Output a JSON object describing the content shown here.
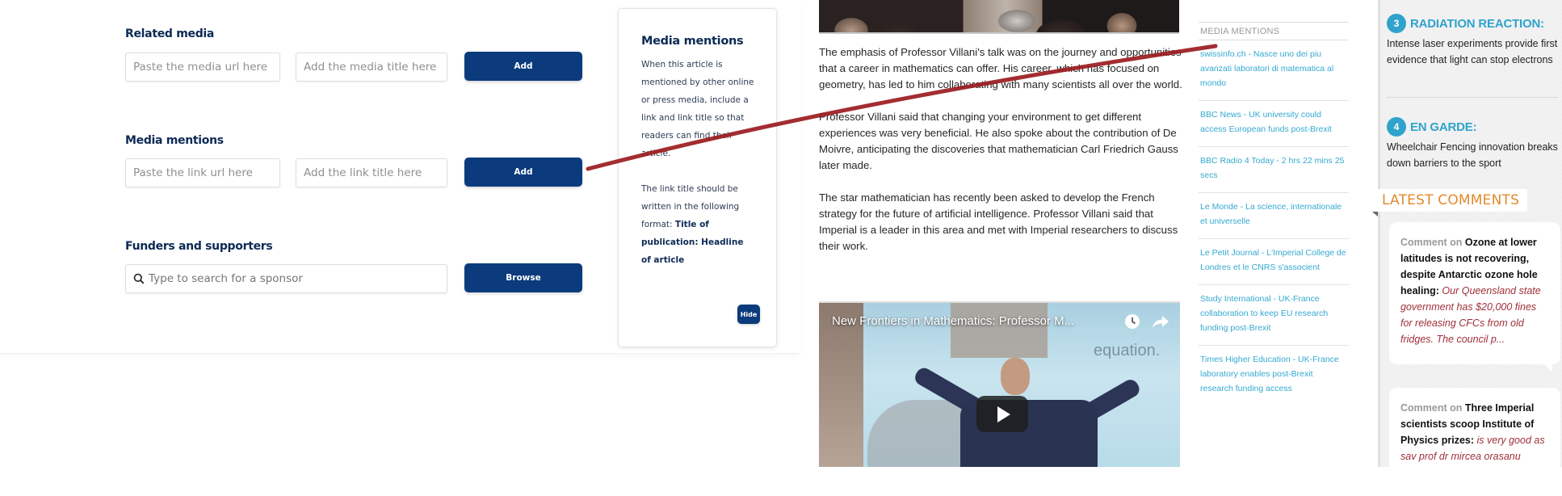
{
  "form": {
    "related_media": {
      "label": "Related media",
      "url_placeholder": "Paste the media url here",
      "title_placeholder": "Add the media title here",
      "button": "Add"
    },
    "media_mentions": {
      "label": "Media mentions",
      "url_placeholder": "Paste the link url here",
      "title_placeholder": "Add the link title here",
      "button": "Add"
    },
    "funders": {
      "label": "Funders and supporters",
      "search_placeholder": "Type to search for a sponsor",
      "button": "Browse"
    }
  },
  "help_card": {
    "title": "Media mentions",
    "para1": "When this article is mentioned by other online or press media, include a link and link title so that readers can find their article.",
    "para2_prefix": "The link title should be written in the following format: ",
    "para2_bold": "Title of publication: Headline of article",
    "hide_button": "Hide"
  },
  "article": {
    "paragraphs": [
      "The emphasis of Professor Villani's talk was on the journey and opportunities that a career in mathematics can offer. His career, which has focused on geometry, has led to him collaborating with many scientists all over the world.",
      "Professor Villani said that changing your environment to get different experiences was very beneficial. He also spoke about the contribution of De Moivre, anticipating the discoveries that mathematician Carl Friedrich Gauss later made.",
      "The star mathematician has recently been asked to develop the French strategy for the future of artificial intelligence. Professor Villani said that Imperial is a leader in this area and met with Imperial researchers to discuss their work."
    ],
    "video": {
      "title": "New Frontiers in Mathematics: Professor M...",
      "slide_text": "equation."
    }
  },
  "media_mentions_sidebar": {
    "heading": "MEDIA MENTIONS",
    "items": [
      "swissinfo.ch - Nasce uno dei piu avanzati laboratori di matematica al mondo",
      "BBC News - UK university could access European funds post-Brexit",
      "BBC Radio 4 Today - 2 hrs 22 mins 25 secs",
      "Le Monde - La science, internationale et universelle",
      "Le Petit Journal - L'Imperial College de Londres et le CNRS s'associent",
      "Study International - UK-France collaboration to keep EU research funding post-Brexit",
      "Times Higher Education - UK-France laboratory enables post-Brexit research funding access"
    ]
  },
  "sidebar": {
    "stories": [
      {
        "number": "3",
        "title": "RADIATION REACTION:",
        "text": "Intense laser experiments provide first evidence that light can stop electrons"
      },
      {
        "number": "4",
        "title": "EN GARDE:",
        "text": "Wheelchair Fencing innovation breaks down barriers to the sport"
      }
    ],
    "latest_comments_heading": "LATEST COMMENTS",
    "comments": [
      {
        "prefix": "Comment on",
        "title": "Ozone at lower latitudes is not recovering, despite Antarctic ozone hole healing:",
        "body": "Our Queensland state government has $20,000 fines for releasing CFCs from old fridges. The council p..."
      },
      {
        "prefix": "Comment on",
        "title": "Three Imperial scientists scoop Institute of Physics prizes:",
        "body": "is very good as sav prof dr mircea orasanu"
      }
    ]
  },
  "colors": {
    "brand_navy": "#0b3b7c",
    "link_blue": "#35a9d1",
    "accent_orange": "#e28a2b",
    "annotation_red": "#9b1b1e"
  }
}
